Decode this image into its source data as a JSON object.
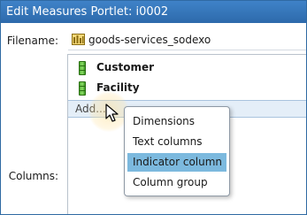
{
  "dialog": {
    "title": "Edit Measures Portlet: i0002"
  },
  "filename": {
    "label": "Filename:",
    "value": "goods-services_sodexo",
    "icon": "database-table-icon",
    "icon_color": "#c8a53a"
  },
  "columns": {
    "label": "Columns:",
    "items": [
      {
        "name": "Customer",
        "icon": "dimension-column-icon"
      },
      {
        "name": "Facility",
        "icon": "dimension-column-icon"
      }
    ],
    "add_label": "Add..."
  },
  "add_menu": {
    "items": [
      "Dimensions",
      "Text columns",
      "Indicator column",
      "Column group"
    ],
    "highlighted": "Indicator column",
    "highlight_color": "#7cb9de"
  }
}
